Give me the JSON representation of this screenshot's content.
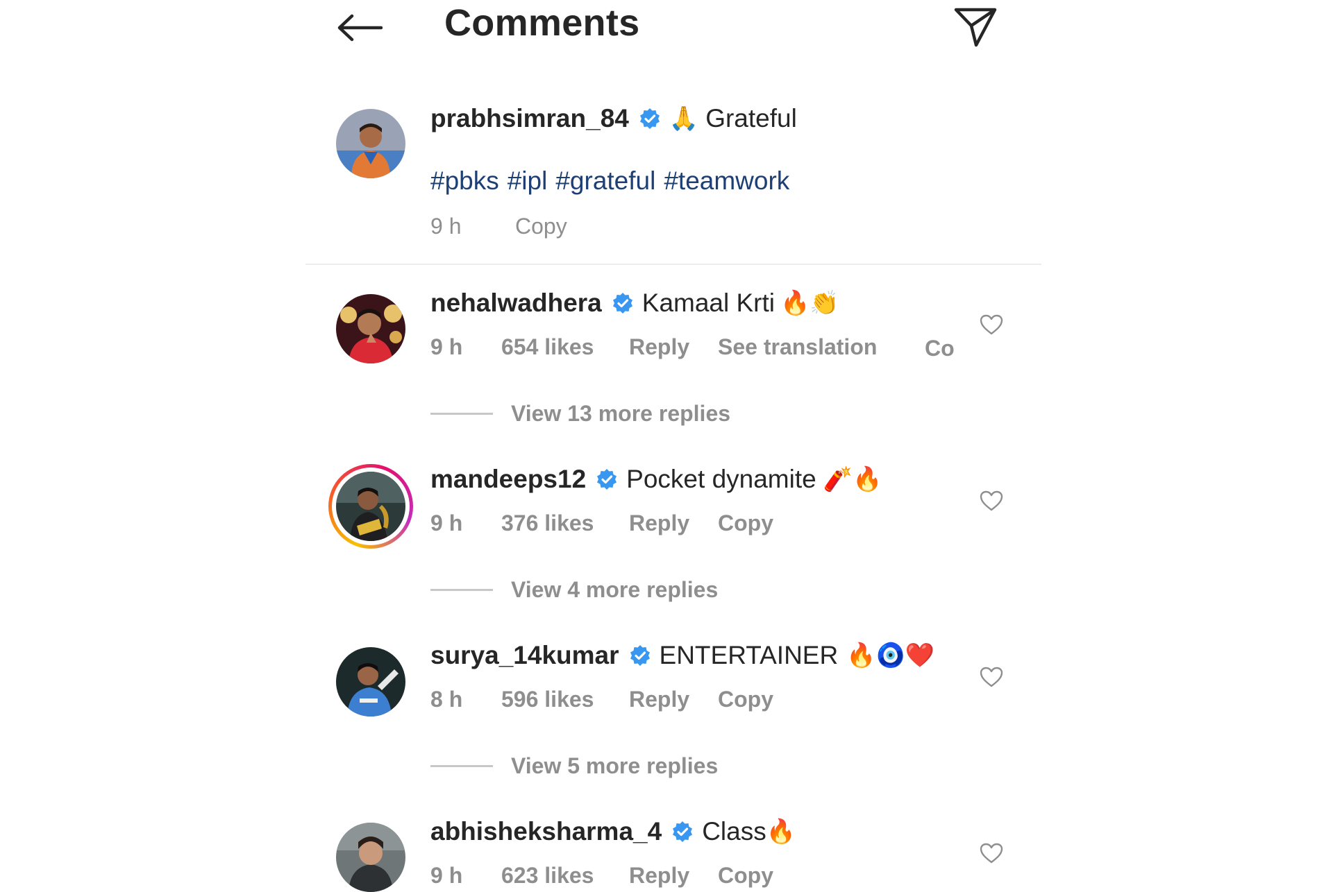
{
  "header": {
    "title": "Comments"
  },
  "caption": {
    "username": "prabhsimran_84",
    "emoji": "🙏",
    "text": "Grateful",
    "hashtags": [
      "#pbks",
      "#ipl",
      "#grateful",
      "#teamwork"
    ],
    "time": "9 h",
    "copy_label": "Copy"
  },
  "comments": [
    {
      "username": "nehalwadhera",
      "text": "Kamaal Krti",
      "emoji": "🔥👏",
      "time": "9 h",
      "likes": "654 likes",
      "reply_label": "Reply",
      "translation_label": "See translation",
      "copy_label": "Copy",
      "view_replies": "View 13 more replies"
    },
    {
      "username": "mandeeps12",
      "text": "Pocket dynamite",
      "emoji": "🧨🔥",
      "time": "9 h",
      "likes": "376 likes",
      "reply_label": "Reply",
      "copy_label": "Copy",
      "view_replies": "View 4 more replies"
    },
    {
      "username": "surya_14kumar",
      "text": "ENTERTAINER",
      "emoji": "🔥🧿❤️",
      "time": "8 h",
      "likes": "596 likes",
      "reply_label": "Reply",
      "copy_label": "Copy",
      "view_replies": "View 5 more replies"
    },
    {
      "username": "abhisheksharma_4",
      "text": "Class",
      "emoji": "🔥",
      "time": "9 h",
      "likes": "623 likes",
      "reply_label": "Reply",
      "copy_label": "Copy"
    }
  ],
  "icons": {
    "back": "arrow-left-icon",
    "send": "paper-plane-icon",
    "verified": "verified-badge-icon",
    "like": "heart-outline-icon"
  },
  "colors": {
    "verified_blue": "#3897f0",
    "hashtag_blue": "#1d3f73",
    "secondary_text": "#8e8e8e",
    "divider": "#ececec"
  }
}
